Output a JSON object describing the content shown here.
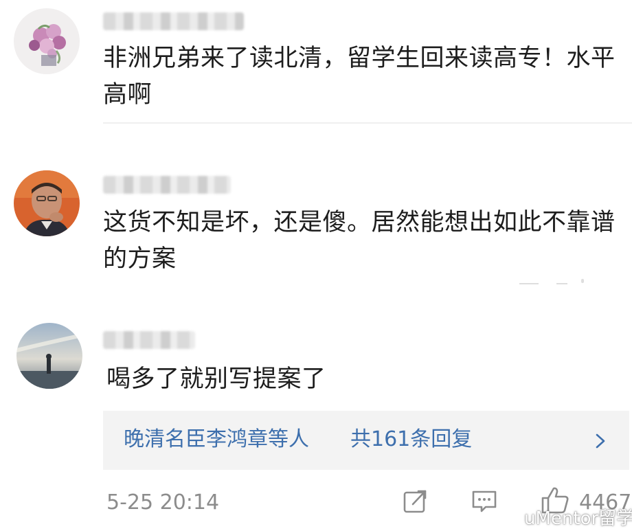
{
  "comments": [
    {
      "username": "",
      "text_line1": "非洲兄弟来了读北清，留学生回来读高专！水平",
      "text_line2": "高啊",
      "avatar_icon": "flower-bouquet-avatar"
    },
    {
      "username": "",
      "text_line1": "这货不知是坏，还是傻。居然能想出如此不靠谱",
      "text_line2": "的方案",
      "avatar_icon": "man-portrait-avatar"
    },
    {
      "username": "",
      "text_line1": "喝多了就别写提案了",
      "avatar_icon": "silhouette-sunset-avatar"
    }
  ],
  "reply_preview": {
    "names": "晚清名臣李鸿章等人",
    "count_text": "共161条回复",
    "chevron_icon": "chevron-right-icon"
  },
  "footer": {
    "timestamp": "5-25 20:14",
    "share_icon": "share-icon",
    "comment_icon": "comment-icon",
    "like_icon": "thumbs-up-icon",
    "like_count": "4467"
  },
  "watermark": {
    "text": "uMentor留学",
    "logo_icon": "weibo-logo-icon"
  },
  "colors": {
    "link": "#3d6fad",
    "meta": "#8c8c8c",
    "reply_bg": "#f3f3f3"
  }
}
